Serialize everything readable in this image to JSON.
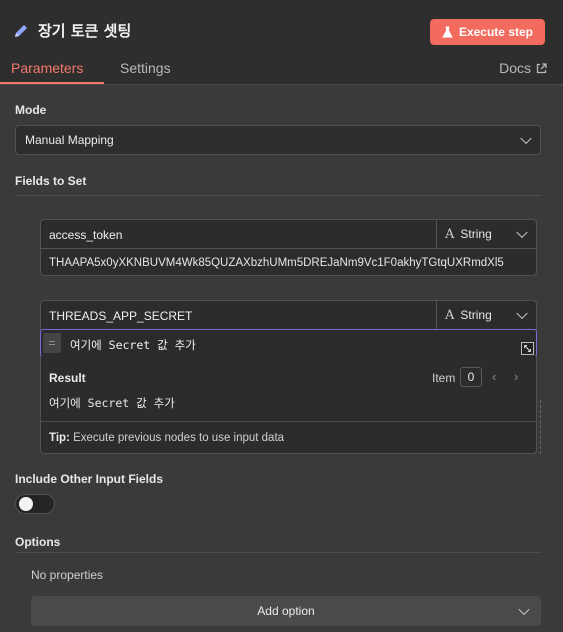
{
  "header": {
    "title": "장기 토큰 셋팅",
    "execute_label": "Execute step",
    "tabs": [
      {
        "label": "Parameters",
        "active": true
      },
      {
        "label": "Settings",
        "active": false
      }
    ],
    "docs_label": "Docs"
  },
  "mode": {
    "label": "Mode",
    "value": "Manual Mapping"
  },
  "fields_to_set": {
    "label": "Fields to Set",
    "fields": [
      {
        "name": "access_token",
        "type": "String",
        "value": "THAAPA5x0yXKNBUVM4Wk85QUZAXbzhUMm5DREJaNm9Vc1F0akhyTGtqUXRmdXl5"
      },
      {
        "name": "THREADS_APP_SECRET",
        "type": "String",
        "expression": "여기에 Secret 값 추가"
      }
    ],
    "result": {
      "title": "Result",
      "item_label": "Item",
      "item_index": "0",
      "value": "여기에 Secret 값 추가",
      "tip_label": "Tip:",
      "tip_text": " Execute previous nodes to use input data"
    }
  },
  "include_other": {
    "label": "Include Other Input Fields",
    "enabled": false
  },
  "options": {
    "label": "Options",
    "empty_text": "No properties",
    "add_label": "Add option"
  },
  "colors": {
    "accent": "#f36a5e",
    "expression_border": "#7d6ad8"
  }
}
